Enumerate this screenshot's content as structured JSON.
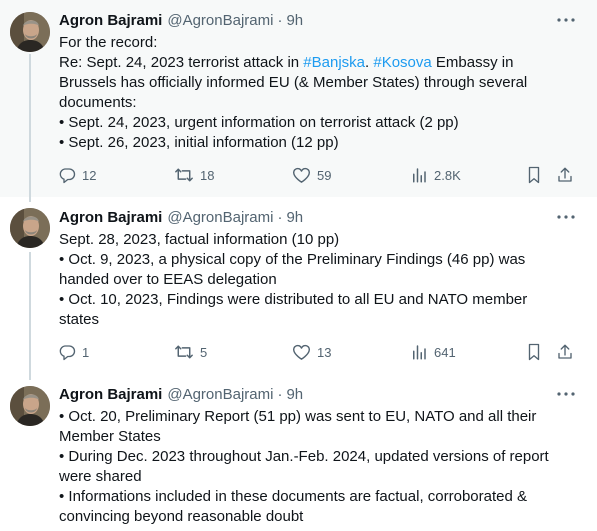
{
  "tweets": [
    {
      "author_name": "Agron Bajrami",
      "handle": "@AgronBajrami",
      "time": "9h",
      "lines": {
        "l1": "For the record:",
        "l2_pre": "Re: Sept. 24, 2023 terrorist attack in ",
        "l2_tag1": "#Banjska",
        "l2_mid": ". ",
        "l2_tag2": "#Kosova",
        "l2_post": " Embassy in",
        "l3": "Brussels has officially informed EU (& Member States) through several",
        "l4": "documents:",
        "l5": "• Sept. 24, 2023, urgent information on terrorist attack (2 pp)",
        "l6": "• Sept. 26, 2023, initial information (12 pp)"
      },
      "stats": {
        "replies": "12",
        "reposts": "18",
        "likes": "59",
        "views": "2.8K"
      }
    },
    {
      "author_name": "Agron Bajrami",
      "handle": "@AgronBajrami",
      "time": "9h",
      "lines": {
        "l1": "Sept. 28, 2023, factual information (10 pp)",
        "l2": "• Oct. 9, 2023, a physical copy of the Preliminary Findings (46 pp) was",
        "l3": "handed over to EEAS delegation",
        "l4": "• Oct. 10, 2023, Findings were distributed to all EU and NATO member",
        "l5": "states"
      },
      "stats": {
        "replies": "1",
        "reposts": "5",
        "likes": "13",
        "views": "641"
      }
    },
    {
      "author_name": "Agron Bajrami",
      "handle": "@AgronBajrami",
      "time": "9h",
      "lines": {
        "l1": "• Oct. 20, Preliminary Report (51 pp) was sent to EU, NATO and all their",
        "l2": "Member States",
        "l3": "• During Dec. 2023 throughout Jan.-Feb. 2024, updated versions of report",
        "l4": "were shared",
        "l5": "• Informations included in these documents are factual, corroborated &",
        "l6": "convincing beyond reasonable doubt"
      }
    }
  ],
  "icons": {
    "reply": "reply-icon",
    "repost": "repost-icon",
    "like": "heart-icon",
    "views": "views-icon",
    "bookmark": "bookmark-icon",
    "share": "share-icon",
    "more": "more-icon"
  },
  "colors": {
    "link": "#1d9bf0",
    "secondary_text": "#536471",
    "highlight_bg": "#f7f9f9",
    "thread_line": "#cfd9de"
  }
}
